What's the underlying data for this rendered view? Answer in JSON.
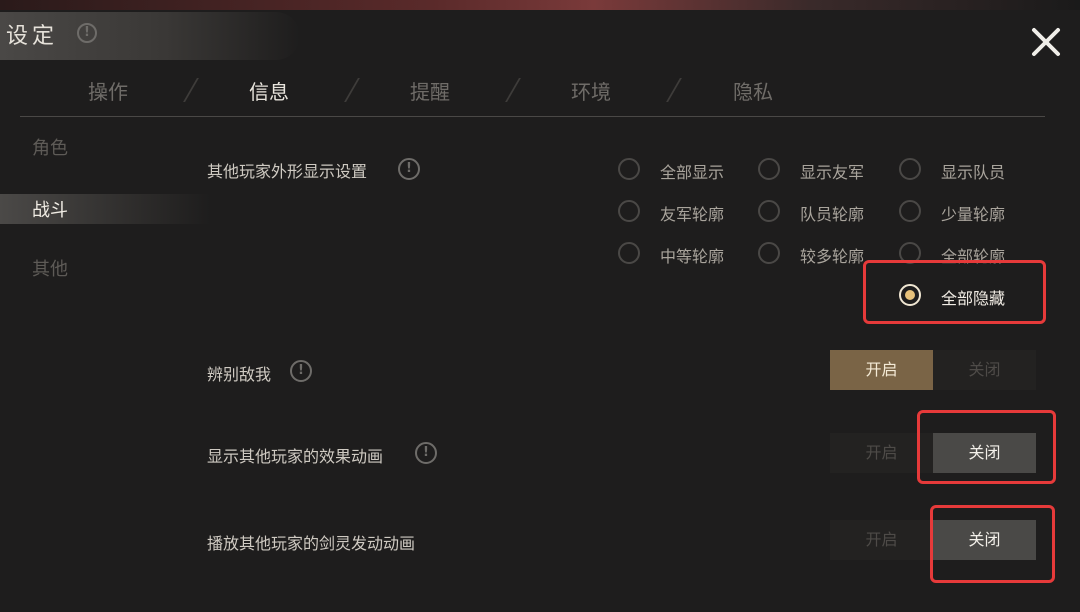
{
  "window": {
    "title": "设定"
  },
  "tabs": [
    {
      "label": "操作",
      "active": false
    },
    {
      "label": "信息",
      "active": true
    },
    {
      "label": "提醒",
      "active": false
    },
    {
      "label": "环境",
      "active": false
    },
    {
      "label": "隐私",
      "active": false
    }
  ],
  "sidebar": {
    "items": [
      {
        "label": "角色",
        "active": false
      },
      {
        "label": "战斗",
        "active": true
      },
      {
        "label": "其他",
        "active": false
      }
    ]
  },
  "settings": {
    "appearance": {
      "label": "其他玩家外形显示设置",
      "options": [
        "全部显示",
        "显示友军",
        "显示队员",
        "友军轮廓",
        "队员轮廓",
        "少量轮廓",
        "中等轮廓",
        "较多轮廓",
        "全部轮廓",
        "全部隐藏"
      ],
      "selected": "全部隐藏"
    },
    "identify": {
      "label": "辨别敌我",
      "on_label": "开启",
      "off_label": "关闭",
      "value": "开启"
    },
    "effects": {
      "label": "显示其他玩家的效果动画",
      "on_label": "开启",
      "off_label": "关闭",
      "value": "关闭"
    },
    "sword": {
      "label": "播放其他玩家的剑灵发动动画",
      "on_label": "开启",
      "off_label": "关闭",
      "value": "关闭"
    }
  },
  "icons": {
    "info": "info-icon",
    "close": "close-icon"
  },
  "info_glyph": "!",
  "colors": {
    "highlight_box": "#e63a3a",
    "gold_toggle": "#7a6446",
    "grey_toggle": "#4a4947"
  }
}
